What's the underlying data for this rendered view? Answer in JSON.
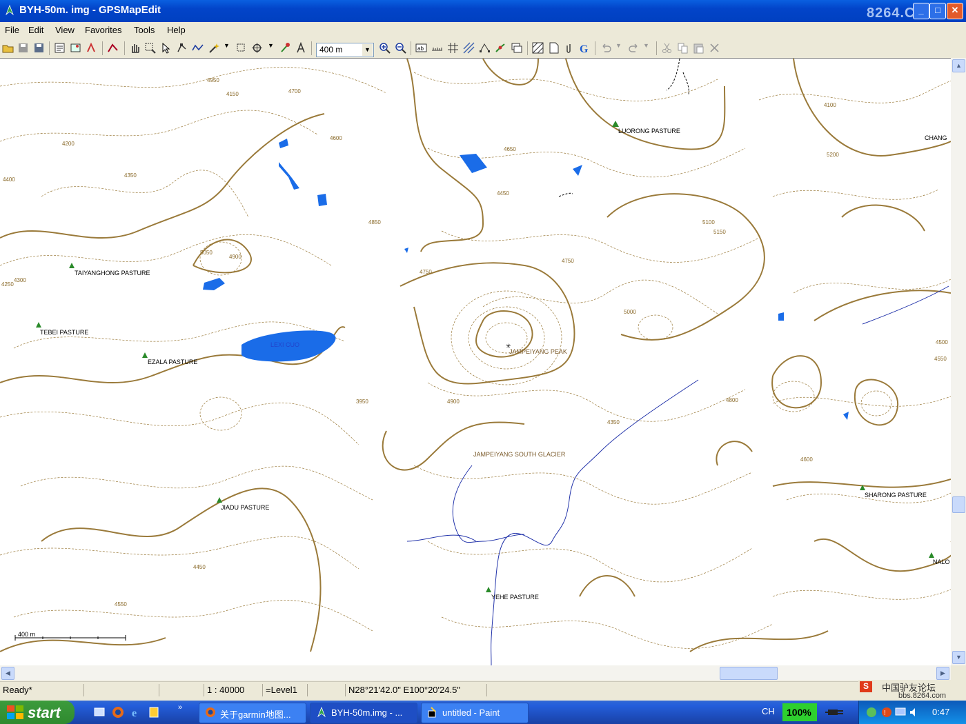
{
  "window": {
    "title": "BYH-50m. img - GPSMapEdit",
    "watermark": "8264.COM"
  },
  "menu": [
    "File",
    "Edit",
    "View",
    "Favorites",
    "Tools",
    "Help"
  ],
  "toolbar": {
    "zoom_value": "400 m"
  },
  "map": {
    "labels": {
      "luorong": "LUORONG PASTURE",
      "chanm": "CHANG",
      "taiyanghong": "TAIYANGHONG PASTURE",
      "tebei": "TEBEI PASTURE",
      "ezala": "EZALA PASTURE",
      "lexi": "LEXI CUO",
      "jampeiyang_peak": "JAMPEIYANG PEAK",
      "glacier": "JAMPEIYANG SOUTH GLACIER",
      "jiadu": "JIADU PASTURE",
      "yehe": "YEHE PASTURE",
      "sharong": "SHARONG PASTURE",
      "nalo": "NALO"
    },
    "elevations": [
      "4950",
      "4150",
      "4700",
      "4400",
      "4600",
      "4200",
      "4850",
      "4350",
      "4900",
      "5050",
      "4650",
      "4450",
      "4750",
      "4300",
      "4250",
      "4550",
      "5000",
      "4800",
      "4500",
      "3950",
      "4100",
      "5100",
      "5150",
      "5200"
    ],
    "scale_label": "400 m"
  },
  "status": {
    "ready": "Ready*",
    "scale": "1 : 40000",
    "level": "=Level1",
    "coords": "N28°21'42.0\" E100°20'24.5\""
  },
  "forum": {
    "line1": "中国驴友论坛",
    "line2": "bbs.8264.com"
  },
  "taskbar": {
    "start": "start",
    "tasks": [
      "关于garmin地图...",
      "BYH-50m.img - ...",
      "untitled - Paint"
    ],
    "lang": "CH",
    "zoom": "100%",
    "clock": "0:47"
  },
  "colors": {
    "contour": "#9a7a3a",
    "water": "#1a6ce8",
    "river": "#2233aa",
    "titlebar": "#0a5fe0"
  }
}
